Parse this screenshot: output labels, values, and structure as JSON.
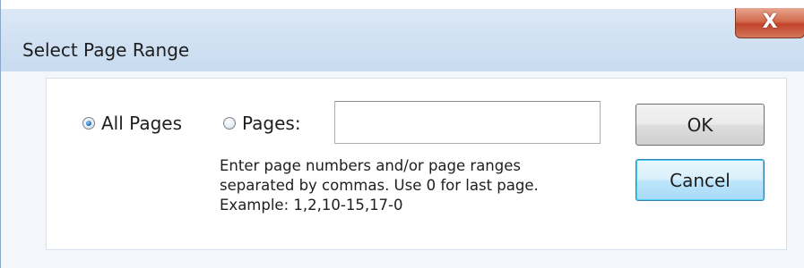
{
  "dialog": {
    "title": "Select Page Range",
    "close_glyph": "X"
  },
  "options": {
    "all_pages_label": "All Pages",
    "pages_label": "Pages:",
    "selected": "All Pages"
  },
  "pages_input": {
    "value": "",
    "placeholder": ""
  },
  "hint": {
    "line1": "Enter page numbers and/or page ranges",
    "line2": "separated by commas. Use 0 for last page.",
    "line3": "Example: 1,2,10-15,17-0"
  },
  "buttons": {
    "ok_label": "OK",
    "cancel_label": "Cancel"
  },
  "colors": {
    "close_button": "#c1442a",
    "default_button_border": "#3c7fb1",
    "titlebar": "#d2e2f3"
  },
  "icons": {
    "close": "close-icon",
    "radio_selected": "radio-selected-icon",
    "radio_unselected": "radio-unselected-icon"
  }
}
